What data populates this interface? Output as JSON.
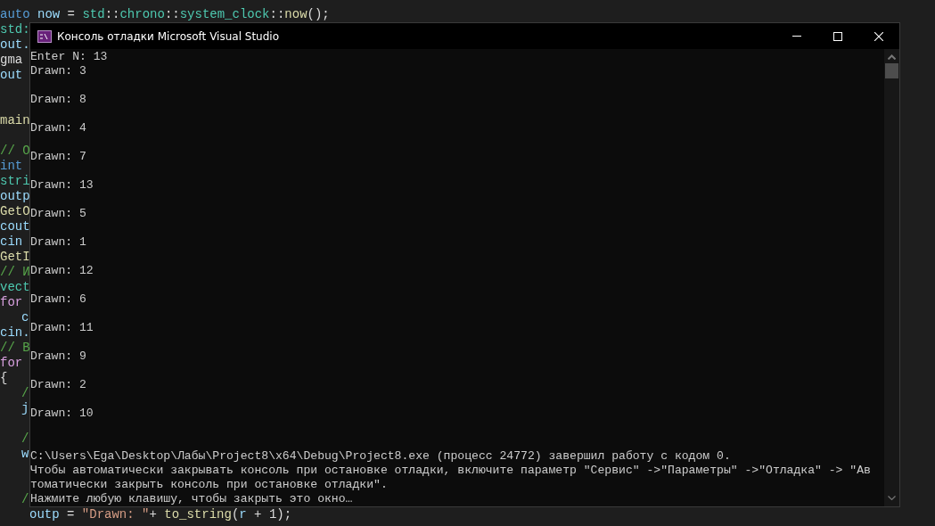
{
  "editor": {
    "lines_above": [
      {
        "indent": false,
        "tokens": [
          {
            "text": "auto",
            "kind": "keyword"
          },
          {
            "text": " now",
            "kind": "variable"
          },
          {
            "text": " = ",
            "kind": "plain"
          },
          {
            "text": "std",
            "kind": "type"
          },
          {
            "text": "::",
            "kind": "plain"
          },
          {
            "text": "chrono",
            "kind": "type"
          },
          {
            "text": "::",
            "kind": "plain"
          },
          {
            "text": "system_clock",
            "kind": "type"
          },
          {
            "text": "::",
            "kind": "plain"
          },
          {
            "text": "now",
            "kind": "function"
          },
          {
            "text": "();",
            "kind": "plain"
          }
        ]
      }
    ],
    "gutter": [
      {
        "kind": "type",
        "text": "std:"
      },
      {
        "kind": "variable",
        "text": "out."
      },
      {
        "kind": "plain",
        "text": "gma"
      },
      {
        "kind": "variable",
        "text": "out"
      },
      {
        "kind": "blank"
      },
      {
        "kind": "blank"
      },
      {
        "kind": "function",
        "text": "main"
      },
      {
        "kind": "blank"
      },
      {
        "kind": "comment",
        "text": "// О"
      },
      {
        "kind": "keyword",
        "text": "int"
      },
      {
        "kind": "type",
        "text": "stri"
      },
      {
        "kind": "variable",
        "text": "outp"
      },
      {
        "kind": "function",
        "text": "GetO"
      },
      {
        "kind": "variable",
        "text": "cout"
      },
      {
        "kind": "variable",
        "text": "cin"
      },
      {
        "kind": "function",
        "text": "GetI"
      },
      {
        "kind": "comment",
        "text": "// И"
      },
      {
        "kind": "type",
        "text": "vect"
      },
      {
        "kind": "control",
        "text": "for"
      },
      {
        "kind": "variable",
        "text": "c",
        "indent": true
      },
      {
        "kind": "variable",
        "text": "cin."
      },
      {
        "kind": "comment",
        "text": "// В"
      },
      {
        "kind": "control",
        "text": "for"
      },
      {
        "kind": "plain",
        "text": "{"
      },
      {
        "kind": "comment",
        "text": "/",
        "indent": true
      },
      {
        "kind": "variable",
        "text": "j",
        "indent": true
      },
      {
        "kind": "blank"
      },
      {
        "kind": "comment",
        "text": "/",
        "indent": true
      },
      {
        "kind": "variable",
        "text": "w",
        "indent": true
      },
      {
        "kind": "blank"
      },
      {
        "kind": "blank"
      },
      {
        "kind": "comment",
        "text": "/",
        "indent": true
      }
    ],
    "lines_below": [
      {
        "indent": true,
        "tokens": [
          {
            "text": "outp",
            "kind": "variable"
          },
          {
            "text": " = ",
            "kind": "plain"
          },
          {
            "text": "\"Drawn: \"",
            "kind": "string"
          },
          {
            "text": "+ ",
            "kind": "plain"
          },
          {
            "text": "to_string",
            "kind": "function"
          },
          {
            "text": "(",
            "kind": "plain"
          },
          {
            "text": "r",
            "kind": "variable"
          },
          {
            "text": " + 1);",
            "kind": "plain"
          }
        ]
      }
    ]
  },
  "console_window": {
    "title": "Консоль отладки Microsoft Visual Studio",
    "lines": [
      {
        "kind": "text",
        "text": "Enter N: 13"
      },
      {
        "kind": "text",
        "text": "Drawn: 3"
      },
      {
        "kind": "blank"
      },
      {
        "kind": "text",
        "text": "Drawn: 8"
      },
      {
        "kind": "blank"
      },
      {
        "kind": "text",
        "text": "Drawn: 4"
      },
      {
        "kind": "blank"
      },
      {
        "kind": "text",
        "text": "Drawn: 7"
      },
      {
        "kind": "blank"
      },
      {
        "kind": "text",
        "text": "Drawn: 13"
      },
      {
        "kind": "blank"
      },
      {
        "kind": "text",
        "text": "Drawn: 5"
      },
      {
        "kind": "blank"
      },
      {
        "kind": "text",
        "text": "Drawn: 1"
      },
      {
        "kind": "blank"
      },
      {
        "kind": "text",
        "text": "Drawn: 12"
      },
      {
        "kind": "blank"
      },
      {
        "kind": "text",
        "text": "Drawn: 6"
      },
      {
        "kind": "blank"
      },
      {
        "kind": "text",
        "text": "Drawn: 11"
      },
      {
        "kind": "blank"
      },
      {
        "kind": "text",
        "text": "Drawn: 9"
      },
      {
        "kind": "blank"
      },
      {
        "kind": "text",
        "text": "Drawn: 2"
      },
      {
        "kind": "blank"
      },
      {
        "kind": "text",
        "text": "Drawn: 10"
      },
      {
        "kind": "blank"
      },
      {
        "kind": "blank"
      },
      {
        "kind": "text",
        "text": "C:\\Users\\Ega\\Desktop\\Лабы\\Project8\\x64\\Debug\\Project8.exe (процесс 24772) завершил работу с кодом 0."
      },
      {
        "kind": "text",
        "text": "Чтобы автоматически закрывать консоль при остановке отладки, включите параметр \"Сервис\" ->\"Параметры\" ->\"Отладка\" -> \"Ав"
      },
      {
        "kind": "text",
        "text": "томатически закрыть консоль при остановке отладки\"."
      },
      {
        "kind": "text",
        "text": "Нажмите любую клавишу, чтобы закрыть это окно…"
      }
    ]
  }
}
